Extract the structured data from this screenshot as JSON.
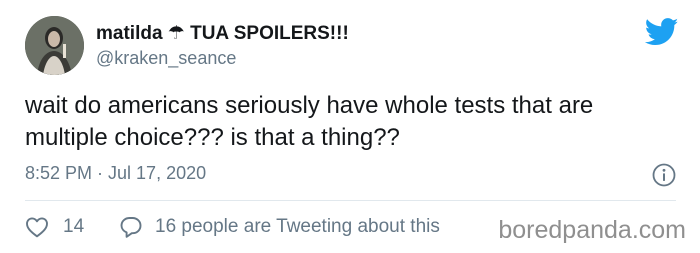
{
  "user": {
    "display_name": "matilda ☂ TUA SPOILERS!!!",
    "handle": "@kraken_seance",
    "avatar_icon": "profile-photo"
  },
  "tweet": {
    "text": "wait do americans seriously have whole tests that are multiple choice??? is that a thing??",
    "timestamp": "8:52 PM · Jul 17, 2020"
  },
  "actions": {
    "like_count": "14",
    "conversation_label": "16 people are Tweeting about this"
  },
  "icons": {
    "brand": "twitter-bird-icon",
    "info": "info-icon",
    "like": "heart-icon",
    "reply": "speech-bubble-icon"
  },
  "colors": {
    "twitter_blue": "#1da1f2",
    "secondary_text": "#657786",
    "primary_text": "#14171a"
  },
  "watermark": "boredpanda.com"
}
